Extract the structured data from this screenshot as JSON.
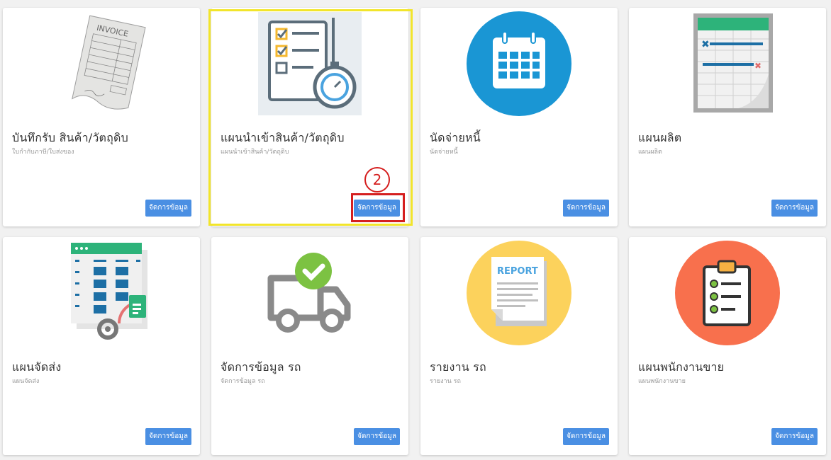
{
  "cards": [
    {
      "title": "บันทึกรับ สินค้า/วัตถุดิบ",
      "subtitle": "ใบกำกับภาษี/ใบส่งของ",
      "button": "จัดการข้อมูล",
      "icon": "invoice-icon"
    },
    {
      "title": "แผนนำเข้าสินค้า/วัตถุดิบ",
      "subtitle": "แผนนำเข้าสินค้า/วัตถุดิบ",
      "button": "จัดการข้อมูล",
      "icon": "checklist-stopwatch-icon"
    },
    {
      "title": "นัดจ่ายหนี้",
      "subtitle": "นัดจ่ายหนี้",
      "button": "จัดการข้อมูล",
      "icon": "calendar-icon"
    },
    {
      "title": "แผนผลิต",
      "subtitle": "แผนผลิต",
      "button": "จัดการข้อมูล",
      "icon": "spreadsheet-icon"
    },
    {
      "title": "แผนจัดส่ง",
      "subtitle": "แผนจัดส่ง",
      "button": "จัดการข้อมูล",
      "icon": "sheet-gear-icon"
    },
    {
      "title": "จัดการข้อมูล รถ",
      "subtitle": "จัดการข้อมูล รถ",
      "button": "จัดการข้อมูล",
      "icon": "truck-check-icon"
    },
    {
      "title": "รายงาน รถ",
      "subtitle": "รายงาน รถ",
      "button": "จัดการข้อมูล",
      "icon": "report-icon"
    },
    {
      "title": "แผนพนักงานขาย",
      "subtitle": "แผนพนักงานขาย",
      "button": "จัดการข้อมูล",
      "icon": "clipboard-icon"
    }
  ],
  "annotation": {
    "step_number": "2"
  },
  "report_label": "REPORT",
  "invoice_label": "INVOICE",
  "colors": {
    "accent": "#4a8fe3",
    "highlight": "#f2e52b",
    "marker": "#d51f1f"
  }
}
